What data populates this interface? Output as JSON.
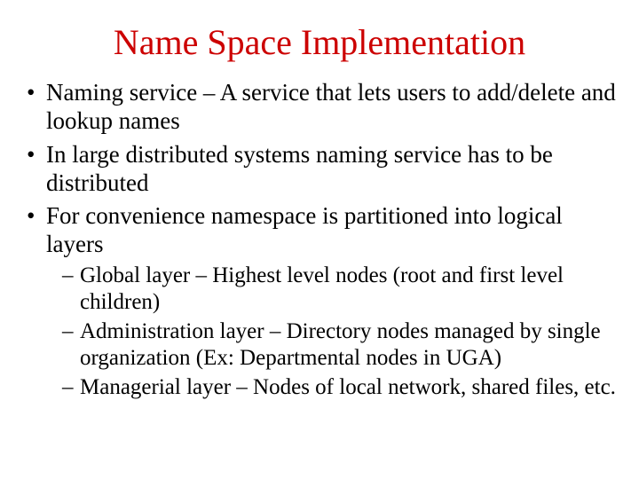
{
  "title": "Name Space Implementation",
  "bullets": [
    {
      "text": "Naming service – A service that lets users to add/delete and lookup names"
    },
    {
      "text": "In large distributed systems naming service has to be distributed"
    },
    {
      "text": "For convenience namespace is partitioned into logical layers",
      "sub": [
        "Global layer – Highest level nodes (root and first level children)",
        "Administration layer – Directory nodes managed by single organization (Ex: Departmental nodes in UGA)",
        "Managerial layer – Nodes of local network, shared files, etc."
      ]
    }
  ]
}
